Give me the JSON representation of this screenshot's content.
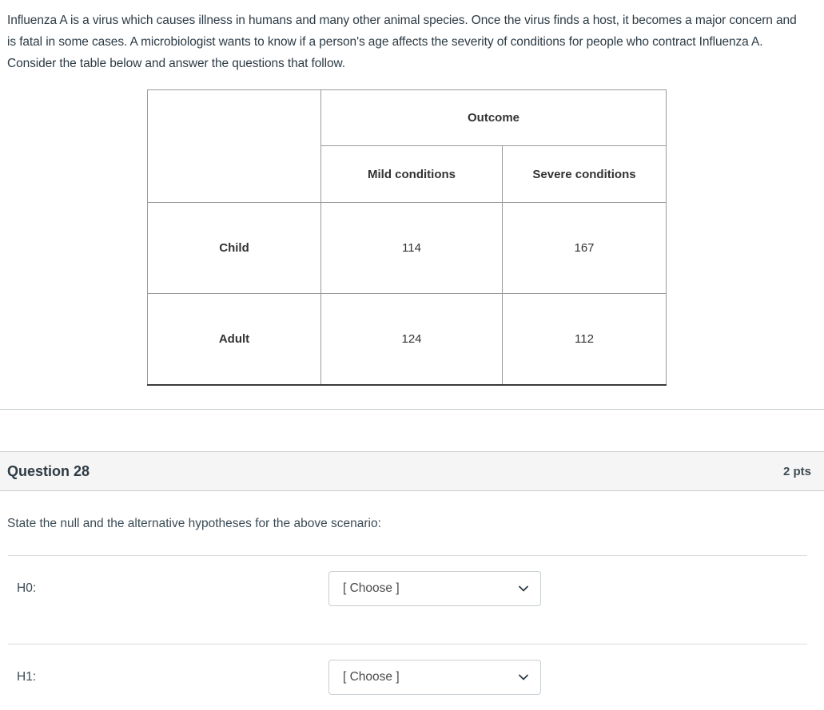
{
  "intro": {
    "paragraph": "Influenza A is a virus which causes illness in humans and many other animal species. Once the virus finds a host, it becomes a major concern and is fatal in some cases. A microbiologist wants to know if a person's age affects the severity of conditions for people who contract Influenza A. Consider the table below and answer the questions that follow."
  },
  "table": {
    "stub_blank": "",
    "group_header": "Outcome",
    "column_headers": [
      "Mild conditions",
      "Severe conditions"
    ],
    "rows": [
      {
        "label": "Child",
        "values": [
          "114",
          "167"
        ]
      },
      {
        "label": "Adult",
        "values": [
          "124",
          "112"
        ]
      }
    ]
  },
  "question": {
    "title": "Question 28",
    "points": "2 pts",
    "prompt": "State the null and the alternative hypotheses for the above scenario:",
    "answers": [
      {
        "label": "H0:",
        "selected": "[ Choose ]",
        "icon": "chevron-down-icon"
      },
      {
        "label": "H1:",
        "selected": "[ Choose ]",
        "icon": "chevron-down-icon"
      }
    ]
  },
  "colors": {
    "header_bar": "#f5f5f5",
    "text": "#2d3b45",
    "border": "#c7cdd1",
    "table_border_strong": "#3b3b3b"
  }
}
